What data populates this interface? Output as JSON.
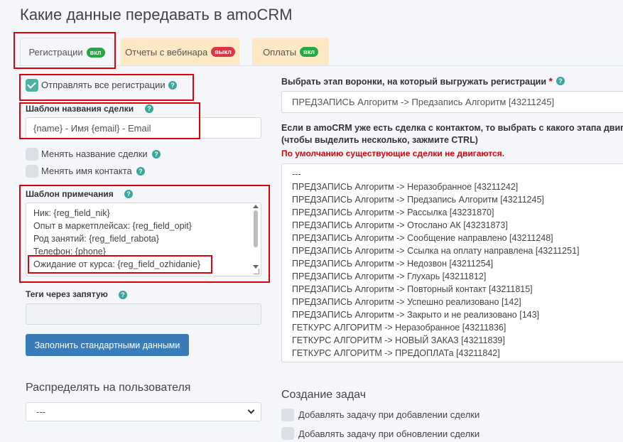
{
  "page": {
    "title": "Какие данные передавать в amoCRM"
  },
  "tabs": [
    {
      "label": "Регистрации",
      "badge": "вкл"
    },
    {
      "label": "Отчеты с вебинара",
      "badge": "выкл"
    },
    {
      "label": "Оплаты",
      "badge": "вкл"
    }
  ],
  "left": {
    "send_all_label": "Отправлять все регистрации",
    "deal_template_label": "Шаблон названия сделки",
    "deal_template_value": "{name} - Имя {email} - Email",
    "change_deal_name_label": "Менять название сделки",
    "change_contact_name_label": "Менять имя контакта",
    "note_template_label": "Шаблон примечания",
    "note_lines": [
      "Ник: {reg_field_nik}",
      "Опыт в маркетплейсах: {reg_field_opit}",
      "Род занятий: {reg_field_rabota}",
      "Телефон: {phone}",
      "Ожидание от курса: {reg_field_ozhidanie}"
    ],
    "tags_label": "Теги через запятую",
    "tags_value": "",
    "fill_button_label": "Заполнить стандартными данными",
    "distribute_title": "Распределять на пользователя",
    "distribute_value": "---"
  },
  "right": {
    "stage_label": "Выбрать этап воронки, на который выгружать регистрации",
    "required_mark": "*",
    "stage_value": "ПРЕДЗАПИСЬ Алгоритм -> Предзапись Алгоритм [43211245]",
    "move_label_line1": "Если в amoCRM уже есть сделка с контактом, то выбрать с какого этапа двигат",
    "move_label_line2": "(чтобы выделить несколько, зажмите CTRL)",
    "move_note": "По умолчанию существующие сделки не двигаются.",
    "stages": [
      "---",
      "ПРЕДЗАПИСЬ Алгоритм -> Неразобранное [43211242]",
      "ПРЕДЗАПИСЬ Алгоритм -> Предзапись Алгоритм [43211245]",
      "ПРЕДЗАПИСЬ Алгоритм -> Рассылка [43231870]",
      "ПРЕДЗАПИСЬ Алгоритм -> Отослано АК [43231873]",
      "ПРЕДЗАПИСЬ Алгоритм -> Сообщение направлено [43211248]",
      "ПРЕДЗАПИСЬ Алгоритм -> Ссылка на оплату направлена [43211251]",
      "ПРЕДЗАПИСЬ Алгоритм -> Недозвон [43211254]",
      "ПРЕДЗАПИСЬ Алгоритм -> Глухарь [43211812]",
      "ПРЕДЗАПИСЬ Алгоритм -> Повторный контакт [43211815]",
      "ПРЕДЗАПИСЬ Алгоритм -> Успешно реализовано [142]",
      "ПРЕДЗАПИСЬ Алгоритм -> Закрыто и не реализовано [143]",
      "ГЕТКУРС АЛГОРИТМ -> Неразобранное [43211836]",
      "ГЕТКУРС АЛГОРИТМ -> НОВЫЙ ЗАКАЗ [43211839]",
      "ГЕТКУРС АЛГОРИТМ -> ПРЕДОПЛАТа [43211842]"
    ],
    "tasks_title": "Создание задач",
    "task_on_add_label": "Добавлять задачу при добавлении сделки",
    "task_on_update_label": "Добавлять задачу при обновлении сделки"
  }
}
